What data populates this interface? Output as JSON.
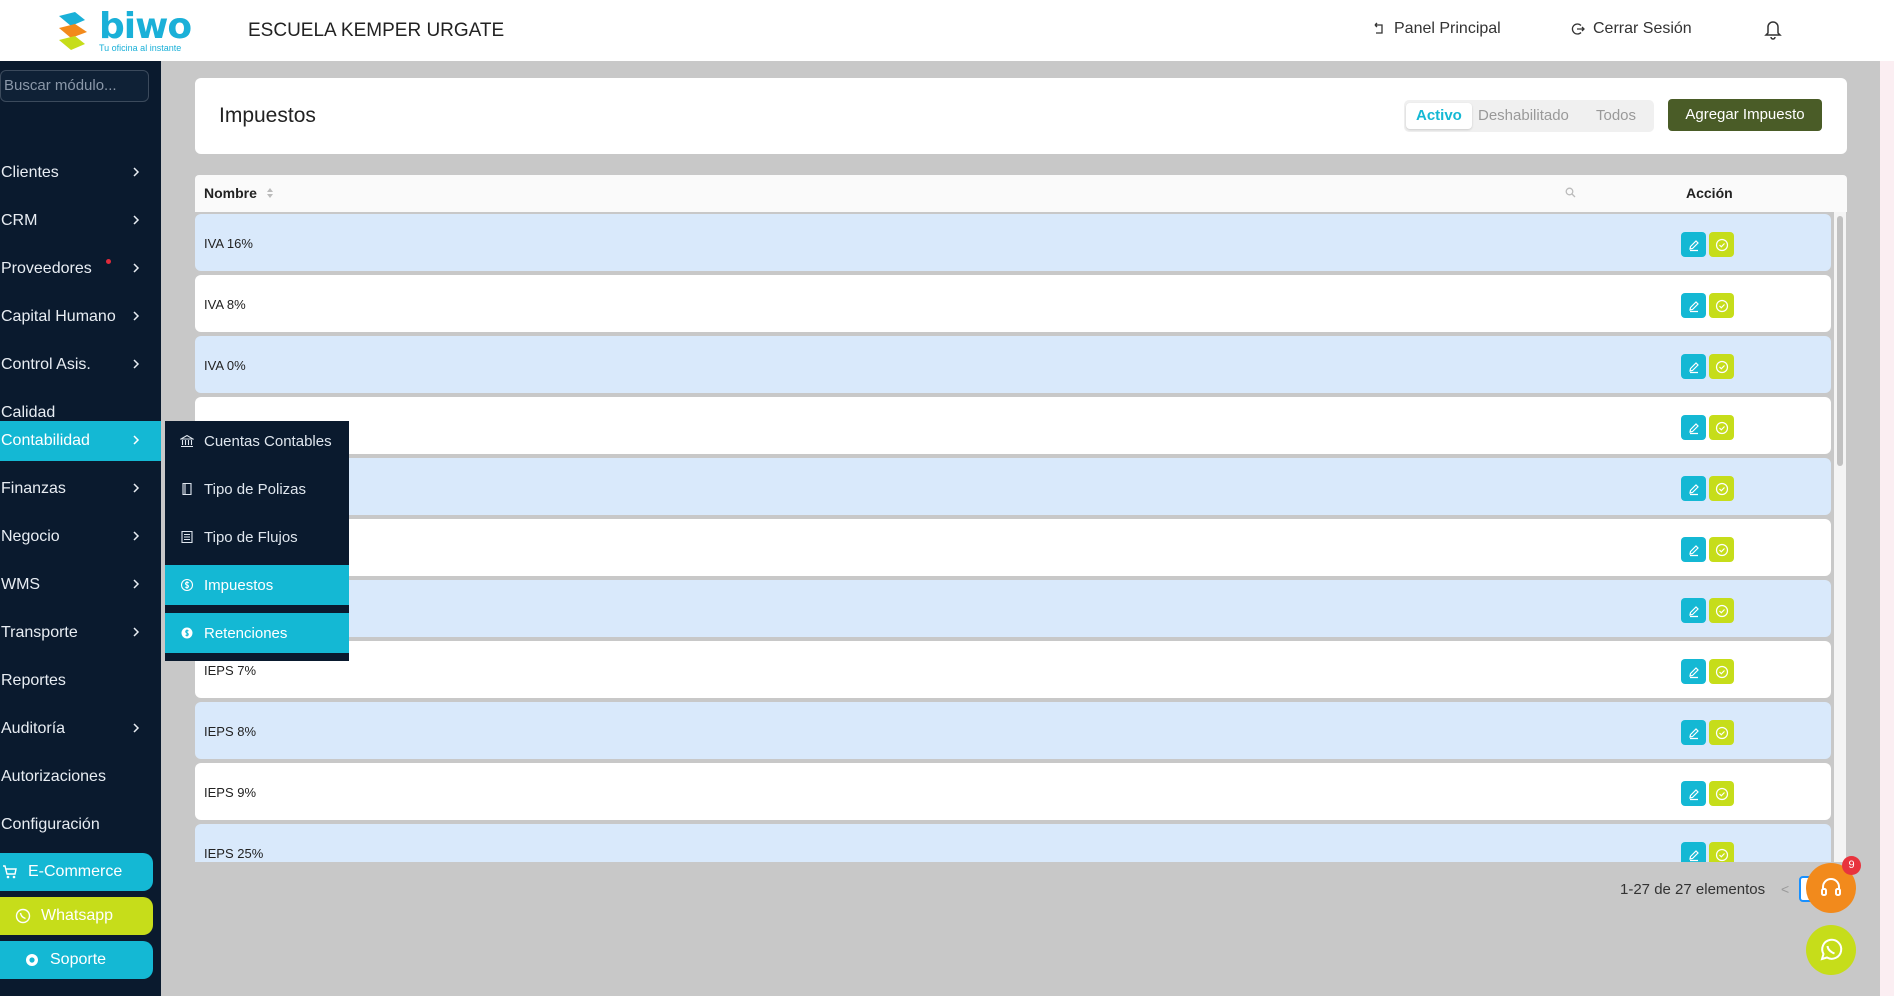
{
  "brand": {
    "name": "biwo",
    "tagline": "Tu oficina al instante"
  },
  "company": "ESCUELA KEMPER URGATE",
  "topnav": {
    "panel": "Panel Principal",
    "logout": "Cerrar Sesión"
  },
  "sidebar": {
    "search_placeholder": "Buscar módulo...",
    "items": [
      {
        "label": "Clientes"
      },
      {
        "label": "CRM"
      },
      {
        "label": "Proveedores"
      },
      {
        "label": "Capital Humano"
      },
      {
        "label": "Control Asis."
      },
      {
        "label": "Calidad"
      },
      {
        "label": "Contabilidad"
      },
      {
        "label": "Finanzas"
      },
      {
        "label": "Negocio"
      },
      {
        "label": "WMS"
      },
      {
        "label": "Transporte"
      },
      {
        "label": "Reportes"
      },
      {
        "label": "Auditoría"
      },
      {
        "label": "Autorizaciones"
      },
      {
        "label": "Configuración"
      }
    ],
    "ecommerce": "E-Commerce",
    "whatsapp": "Whatsapp",
    "soporte": "Soporte"
  },
  "submenu": {
    "items": [
      {
        "label": "Cuentas Contables"
      },
      {
        "label": "Tipo de Polizas"
      },
      {
        "label": "Tipo de Flujos"
      },
      {
        "label": "Impuestos"
      },
      {
        "label": "Retenciones"
      }
    ]
  },
  "page": {
    "title": "Impuestos",
    "filters": [
      "Activo",
      "Deshabilitado",
      "Todos"
    ],
    "add_button": "Agregar Impuesto"
  },
  "table": {
    "columns": [
      "Nombre",
      "Acción"
    ],
    "rows": [
      "IVA 16%",
      "IVA 8%",
      "IVA 0%",
      "",
      "",
      "",
      "",
      "IEPS 7%",
      "IEPS 8%",
      "IEPS 9%",
      "IEPS 25%"
    ]
  },
  "pagination": {
    "summary": "1-27 de 27 elementos"
  },
  "notifications": {
    "support_badge": "9"
  },
  "colors": {
    "accent": "#14b8d4",
    "sidebar": "#0a1a2e",
    "add_button": "#4a5c27",
    "ok_button": "#c6dd1a",
    "row_alt": "#d9e9fb"
  }
}
